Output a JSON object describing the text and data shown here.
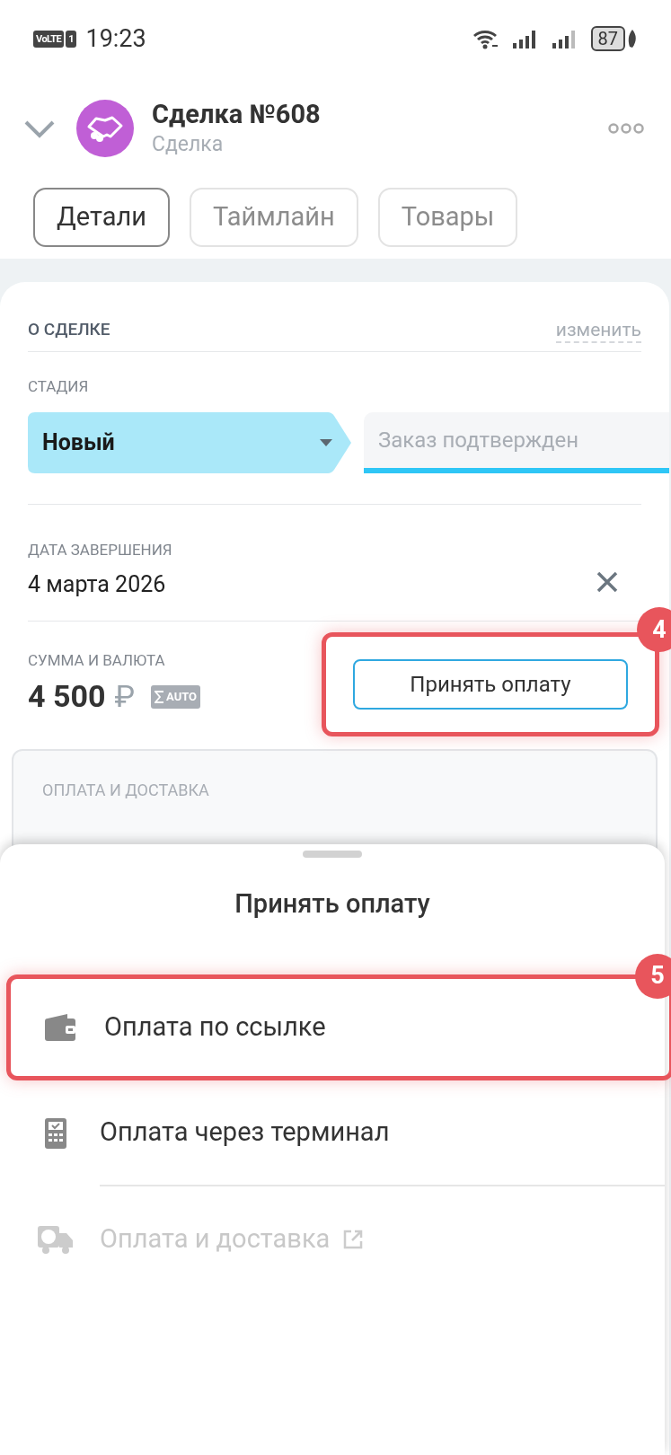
{
  "status_bar": {
    "volte": "VoLTE",
    "sim": "1",
    "time": "19:23",
    "battery": "87"
  },
  "header": {
    "title": "Сделка №608",
    "subtitle": "Сделка"
  },
  "tabs": [
    {
      "label": "Детали",
      "selected": true
    },
    {
      "label": "Таймлайн",
      "selected": false
    },
    {
      "label": "Товары",
      "selected": false
    }
  ],
  "about": {
    "heading": "О СДЕЛКЕ",
    "edit_link": "изменить"
  },
  "stage": {
    "label": "СТАДИЯ",
    "stages": [
      {
        "name": "Новый",
        "selected": true
      },
      {
        "name": "Заказ подтвержден",
        "selected": false
      }
    ]
  },
  "close_date": {
    "label": "ДАТА ЗАВЕРШЕНИЯ",
    "value": "4 марта 2026"
  },
  "amount": {
    "label": "СУММА И ВАЛЮТА",
    "value": "4 500",
    "currency": "₽",
    "badge": "AUTO",
    "button": "Принять оплату",
    "callout": "4"
  },
  "payment_card": {
    "heading": "ОПЛАТА И ДОСТАВКА"
  },
  "sheet": {
    "title": "Принять оплату",
    "items": [
      {
        "kind": "wallet",
        "label": "Оплата по ссылке",
        "disabled": false,
        "external": false,
        "callout": "5"
      },
      {
        "kind": "terminal",
        "label": "Оплата через терминал",
        "disabled": false,
        "external": false
      },
      {
        "kind": "delivery",
        "label": "Оплата и доставка",
        "disabled": true,
        "external": true
      }
    ]
  }
}
